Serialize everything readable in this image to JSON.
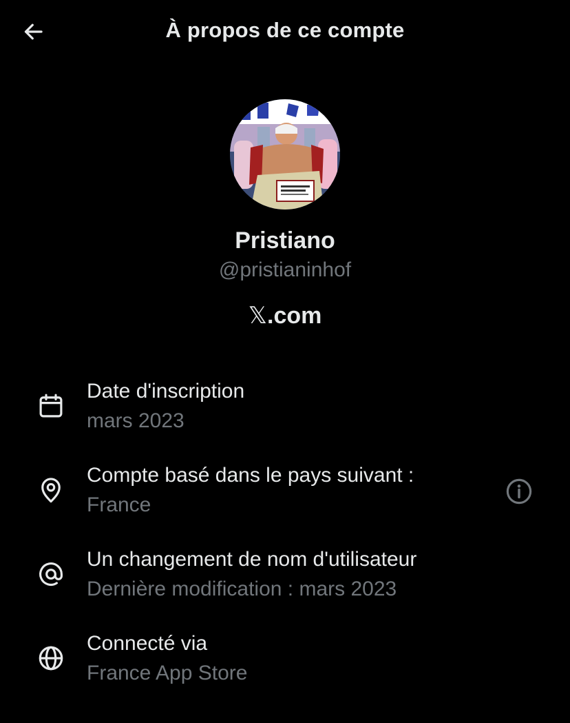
{
  "header": {
    "title": "À propos de ce compte",
    "back_icon": "arrow-left-icon"
  },
  "profile": {
    "display_name": "Pristiano",
    "handle": "@pristianinhof",
    "platform_symbol": "𝕏",
    "platform_suffix": ".com"
  },
  "details": [
    {
      "icon": "calendar-icon",
      "label": "Date d'inscription",
      "value": "mars 2023"
    },
    {
      "icon": "location-pin-icon",
      "label": "Compte basé dans le pays suivant :",
      "value": "France",
      "action_icon": "info-icon"
    },
    {
      "icon": "at-sign-icon",
      "label": "Un changement de nom d'utilisateur",
      "value": "Dernière modification : mars 2023"
    },
    {
      "icon": "globe-icon",
      "label": "Connecté via",
      "value": "France App Store"
    }
  ],
  "colors": {
    "background": "#000000",
    "primary_text": "#e7e9ea",
    "secondary_text": "#71767b"
  }
}
